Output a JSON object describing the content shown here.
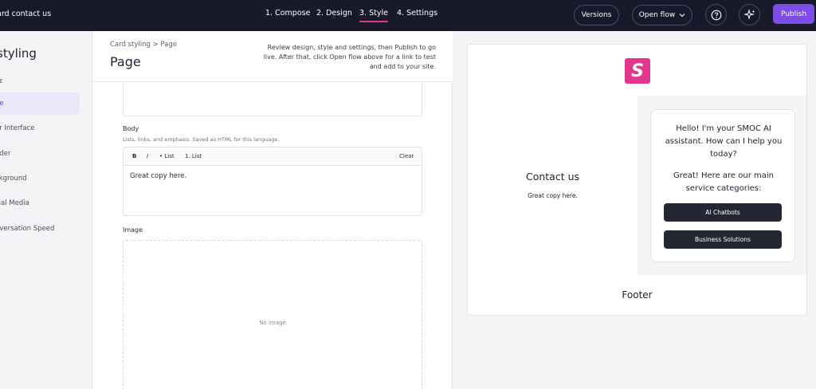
{
  "topbar": {
    "title": "ard contact us",
    "steps": [
      {
        "label": "1. Compose",
        "active": false
      },
      {
        "label": "2. Design",
        "active": false
      },
      {
        "label": "3. Style",
        "active": true
      },
      {
        "label": "4. Settings",
        "active": false
      }
    ],
    "versions_label": "Versions",
    "open_flow_label": "Open flow",
    "help_icon": "help-icon",
    "sparkle_icon": "sparkle-icon",
    "publish_label": "Publish",
    "accent_color": "#7c4ee6",
    "active_underline_color": "#e0388e"
  },
  "sidebar": {
    "heading": "styling",
    "section_label": "CE",
    "items": [
      {
        "label": "ge",
        "active": true
      },
      {
        "label": "er Interface",
        "active": false
      },
      {
        "label": "ader",
        "active": false
      },
      {
        "label": "ckground",
        "active": false
      },
      {
        "label": "cial Media",
        "active": false
      },
      {
        "label": "nversation Speed",
        "active": false
      }
    ]
  },
  "editor": {
    "breadcrumb": "Card styling > Page",
    "title": "Page",
    "hint": "Review design, style and settings, then Publish to go live. After that, click Open flow above for a link to test and add to your site.",
    "body": {
      "label": "Body",
      "help": "Lists, links, and emphasis. Saved as HTML for this language.",
      "toolbar": {
        "bold": "B",
        "italic": "I",
        "bullet_list": "• List",
        "numbered_list": "1. List",
        "clear": "Clear"
      },
      "value": "Great copy here."
    },
    "image": {
      "label": "Image",
      "placeholder": "No image"
    }
  },
  "preview": {
    "logo_letter": "S",
    "logo_color": "#e0388e",
    "heading": "Contact us",
    "body": "Great copy here.",
    "chat": {
      "greeting": "Hello! I'm your SMOC AI assistant. How can I help you today?",
      "follow_up": "Great! Here are our main service categories:",
      "options": [
        "AI Chatbots",
        "Business Solutions"
      ]
    },
    "footer": "Footer"
  }
}
